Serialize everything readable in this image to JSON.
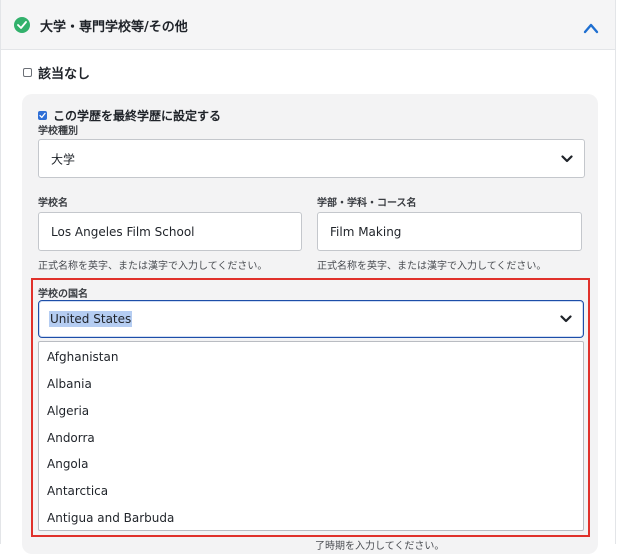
{
  "section": {
    "title": "大学・専門学校等/その他",
    "status_color": "#32b16c"
  },
  "none_checkbox": {
    "label": "該当なし",
    "checked": false
  },
  "final_education": {
    "label": "この学歴を最終学歴に設定する",
    "checked": true
  },
  "school_type": {
    "label": "学校種別",
    "value": "大学"
  },
  "school_name": {
    "label": "学校名",
    "value": "Los Angeles Film School",
    "hint": "正式名称を英字、または漢字で入力してください。"
  },
  "faculty": {
    "label": "学部・学科・コース名",
    "value": "Film Making",
    "hint": "正式名称を英字、または漢字で入力してください。"
  },
  "country": {
    "label": "学校の国名",
    "value": "United States",
    "options": [
      "Afghanistan",
      "Albania",
      "Algeria",
      "Andorra",
      "Angola",
      "Antarctica",
      "Antigua and Barbuda"
    ]
  },
  "partial_hint": "了時期を入力してください。",
  "colors": {
    "highlight_border": "#e0312b",
    "focus_border": "#1d4ea8",
    "selection_bg": "#b5cdf2"
  }
}
